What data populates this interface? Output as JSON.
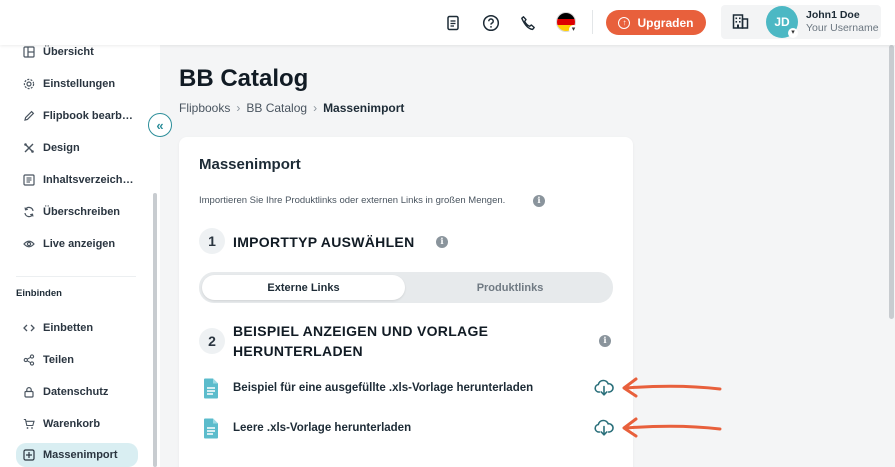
{
  "header": {
    "upgrade_label": "Upgraden",
    "user_initials": "JD",
    "user_name": "John1 Doe",
    "user_subtitle": "Your Username",
    "icons": [
      "document-icon",
      "help-icon",
      "phone-icon",
      "german-flag-icon",
      "building-icon"
    ],
    "flag_colors": [
      "#000000",
      "#dd0000",
      "#ffce00"
    ]
  },
  "sidebar": {
    "items": [
      {
        "label": "Übersicht",
        "icon": "overview-icon"
      },
      {
        "label": "Einstellungen",
        "icon": "settings-icon"
      },
      {
        "label": "Flipbook bearb…",
        "icon": "pencil-icon"
      },
      {
        "label": "Design",
        "icon": "design-icon"
      },
      {
        "label": "Inhaltsverzeich…",
        "icon": "toc-icon"
      },
      {
        "label": "Überschreiben",
        "icon": "refresh-icon"
      },
      {
        "label": "Live anzeigen",
        "icon": "eye-icon"
      }
    ],
    "section_label": "Einbinden",
    "embed_items": [
      {
        "label": "Einbetten",
        "icon": "code-icon"
      },
      {
        "label": "Teilen",
        "icon": "share-icon"
      },
      {
        "label": "Datenschutz",
        "icon": "lock-icon"
      },
      {
        "label": "Warenkorb",
        "icon": "cart-icon"
      },
      {
        "label": "Massenimport",
        "icon": "import-icon",
        "active": true
      }
    ]
  },
  "main": {
    "title": "BB Catalog",
    "breadcrumb": [
      "Flipbooks",
      "BB Catalog",
      "Massenimport"
    ],
    "card": {
      "title": "Massenimport",
      "description": "Importieren Sie Ihre Produktlinks oder externen Links in großen Mengen.",
      "step1": {
        "number": "1",
        "title": "IMPORTTYP AUSWÄHLEN"
      },
      "toggle": {
        "active": "Externe Links",
        "inactive": "Produktlinks"
      },
      "step2": {
        "number": "2",
        "title_line1": "BEISPIEL ANZEIGEN UND VORLAGE",
        "title_line2": "HERUNTERLADEN"
      },
      "downloads": [
        {
          "label": "Beispiel für eine ausgefüllte .xls-Vorlage herunterladen"
        },
        {
          "label": "Leere .xls-Vorlage herunterladen"
        }
      ]
    }
  },
  "colors": {
    "accent": "#e8603c",
    "teal": "#2c8e9a",
    "avatar": "#4cb8c4",
    "doc_icon": "#5bbccc"
  }
}
